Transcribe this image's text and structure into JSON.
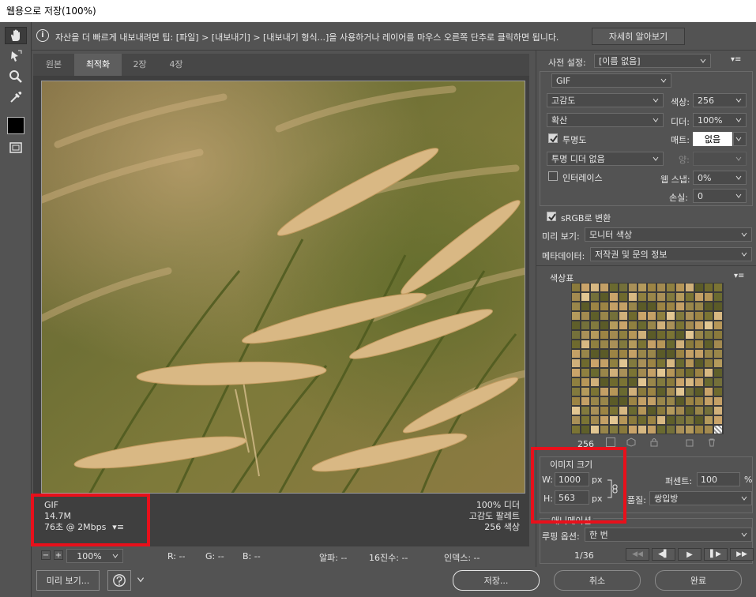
{
  "window": {
    "title": "웹용으로 저장(100%)"
  },
  "tip": {
    "text": "자산을 더 빠르게 내보내려면 팁: [파일] > [내보내기] > [내보내기 형식...]을 사용하거나 레이어를 마우스 오른쪽 단추로 클릭하면 됩니다.",
    "learn_more": "자세히 알아보기"
  },
  "tabs": [
    "원본",
    "최적화",
    "2장",
    "4장"
  ],
  "image_info_left": {
    "format": "GIF",
    "size": "14.7M",
    "time": "76초 @ 2Mbps",
    "menu_icon": "▾≡"
  },
  "image_info_right": {
    "dither": "100% 디더",
    "palette": "고감도 팔레트",
    "colors": "256 색상"
  },
  "status": {
    "zoom": "100%",
    "r": "R: --",
    "g": "G: --",
    "b": "B: --",
    "alpha": "알파: --",
    "hex": "16진수: --",
    "index": "인덱스: --"
  },
  "preset": {
    "label": "사전 설정:",
    "value": "[이름 없음]",
    "format": "GIF",
    "reduction": "고감도",
    "dither_algo": "확산",
    "colors_label": "색상:",
    "colors_value": "256",
    "dither_label": "디더:",
    "dither_value": "100%",
    "transparency_label": "투명도",
    "matte_label": "매트:",
    "matte_value": "없음",
    "trans_dither": "투명 디더 없음",
    "amount_label": "양:",
    "interlace_label": "인터레이스",
    "websnap_label": "웹 스냅:",
    "websnap_value": "0%",
    "lossy_label": "손실:",
    "lossy_value": "0",
    "srgb_label": "sRGB로 변환",
    "preview_label": "미리 보기:",
    "preview_value": "모니터 색상",
    "metadata_label": "메타데이터:",
    "metadata_value": "저작권 및 문의 정보"
  },
  "color_table": {
    "title": "색상표",
    "count": "256",
    "swatches": [
      "#8a7a3c",
      "#b49a5c",
      "#6f6a2e",
      "#caa46a",
      "#9c8444",
      "#7b7434",
      "#d7b882",
      "#a38a50",
      "#5f5f2a",
      "#c4a066",
      "#8f8040",
      "#e2c692",
      "#6a6a30",
      "#b69658",
      "#99864a",
      "#74703a",
      "#d0b07a",
      "#827a3e",
      "#a99058",
      "#5b5b28"
    ]
  },
  "image_size": {
    "title": "이미지 크기",
    "w_label": "W:",
    "w_value": "1000",
    "h_label": "H:",
    "h_value": "563",
    "unit": "px",
    "percent_label": "퍼센트:",
    "percent_value": "100",
    "percent_unit": "%",
    "quality_label": "품질:",
    "quality_value": "쌍입방"
  },
  "animation": {
    "title": "애니메이션",
    "loop_label": "루핑 옵션:",
    "loop_value": "한 번",
    "frame": "1/36"
  },
  "buttons": {
    "preview": "미리 보기...",
    "save": "저장...",
    "cancel": "취소",
    "done": "완료"
  },
  "colors": {
    "accent_red": "#e8101b",
    "bg": "#535353"
  }
}
